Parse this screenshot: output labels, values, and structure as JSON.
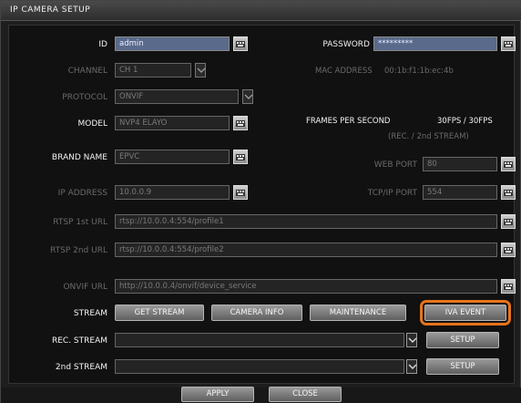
{
  "window": {
    "title": "IP CAMERA SETUP"
  },
  "left": {
    "id": {
      "label": "ID",
      "value": "admin"
    },
    "channel": {
      "label": "CHANNEL",
      "value": "CH 1"
    },
    "protocol": {
      "label": "PROTOCOL",
      "value": "ONVIF"
    },
    "model": {
      "label": "MODEL",
      "value": "NVP4 ELAYO"
    },
    "brand": {
      "label": "BRAND NAME",
      "value": "EPVC"
    },
    "ip": {
      "label": "IP ADDRESS",
      "value": "10.0.0.9"
    }
  },
  "right": {
    "password": {
      "label": "PASSWORD",
      "value": "*********"
    },
    "mac": {
      "label": "MAC ADDRESS",
      "value": "00:1b:f1:1b:ec:4b"
    },
    "fps": {
      "label": "FRAMES PER SECOND",
      "value": "30FPS / 30FPS",
      "sub": "(REC. / 2nd STREAM)"
    },
    "web_port": {
      "label": "WEB PORT",
      "value": "80"
    },
    "tcp_port": {
      "label": "TCP/IP PORT",
      "value": "554"
    }
  },
  "urls": {
    "rtsp1": {
      "label": "RTSP 1st URL",
      "value": "rtsp://10.0.0.4:554/profile1"
    },
    "rtsp2": {
      "label": "RTSP 2nd URL",
      "value": "rtsp://10.0.0.4:554/profile2"
    },
    "onvif": {
      "label": "ONVIF URL",
      "value": "http://10.0.0.4/onvif/device_service"
    }
  },
  "stream": {
    "label": "STREAM",
    "buttons": [
      "GET STREAM",
      "CAMERA INFO",
      "MAINTENANCE",
      "IVA EVENT"
    ],
    "rec_label": "REC. STREAM",
    "second_label": "2nd STREAM",
    "setup": "SETUP"
  },
  "footer": {
    "apply": "APPLY",
    "close": "CLOSE"
  },
  "colors": {
    "highlight": "#e8731a"
  }
}
